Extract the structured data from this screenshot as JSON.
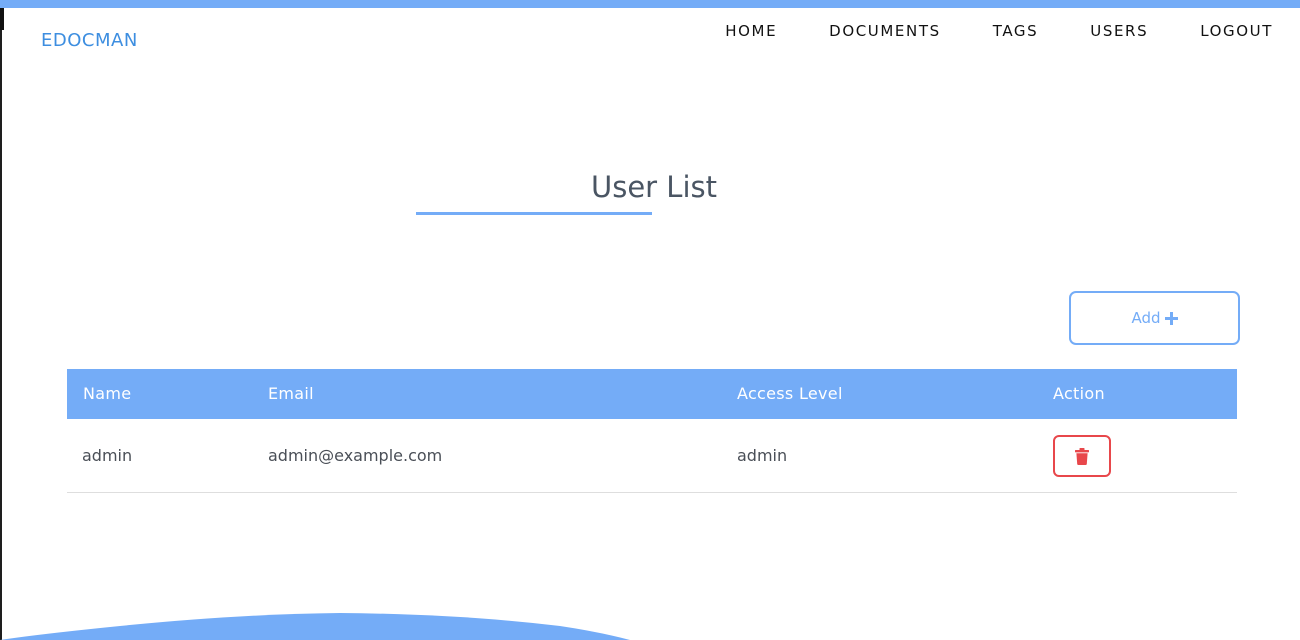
{
  "colors": {
    "accent": "#74acf7",
    "brand": "#3d8ee0",
    "danger": "#e8474b",
    "nav_text": "#111111",
    "title_text": "#4a5563"
  },
  "brand": {
    "name": "EDOCMAN"
  },
  "nav": {
    "items": [
      "HOME",
      "DOCUMENTS",
      "TAGS",
      "USERS",
      "LOGOUT"
    ]
  },
  "main": {
    "title": "User List",
    "add_button_label": "Add",
    "add_button_icon": "plus-icon"
  },
  "table": {
    "columns": [
      "Name",
      "Email",
      "Access Level",
      "Action"
    ],
    "rows": [
      {
        "name": "admin",
        "email": "admin@example.com",
        "access_level": "admin",
        "action_icon": "trash-icon"
      }
    ]
  }
}
